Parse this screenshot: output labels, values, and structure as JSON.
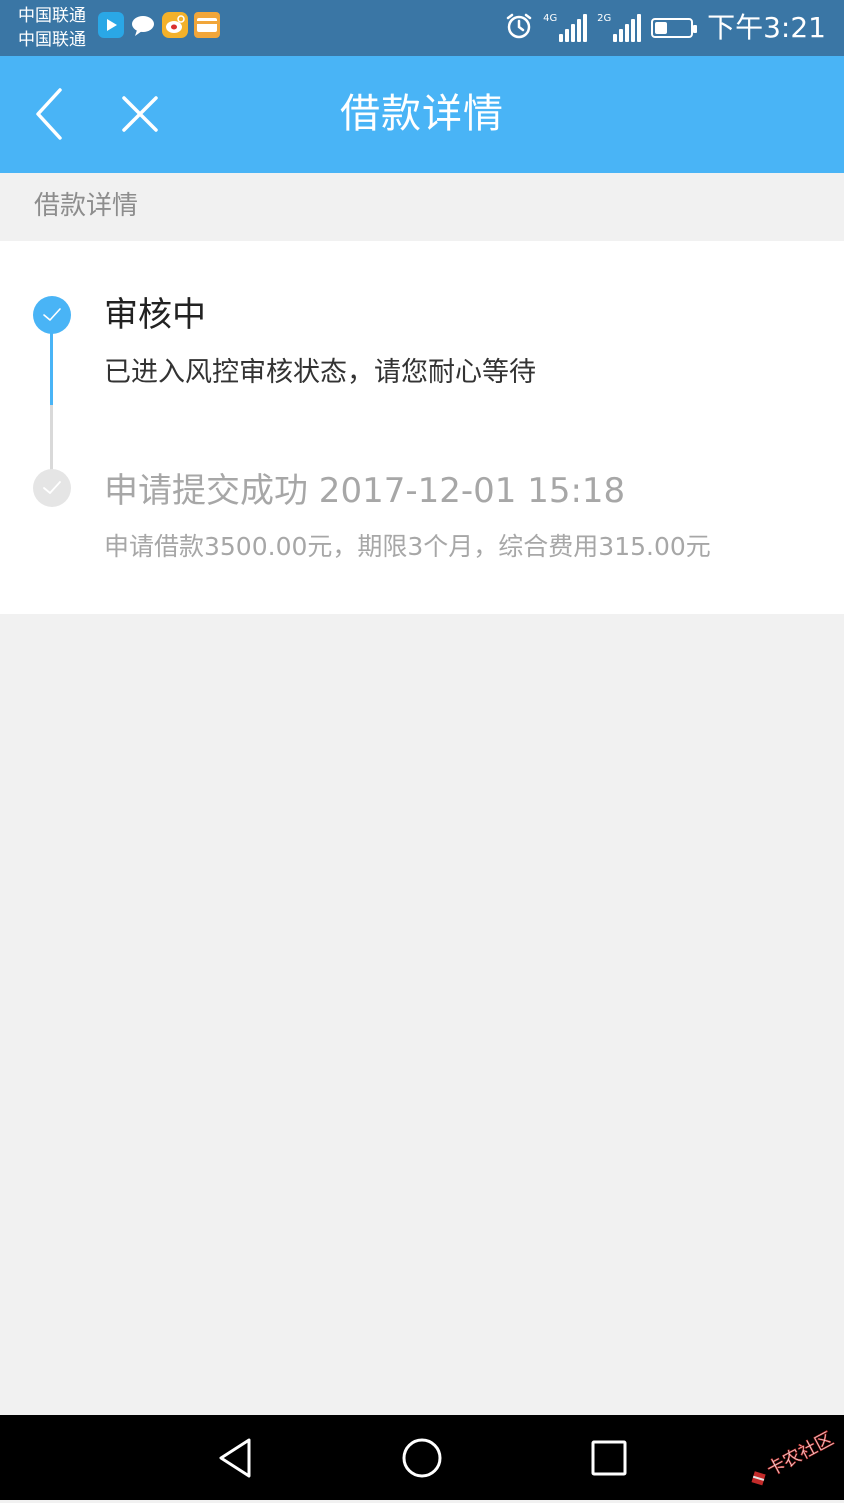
{
  "status_bar": {
    "carrier_1": "中国联通",
    "carrier_2": "中国联通",
    "time": "下午3:21",
    "network_1": "4G",
    "network_2": "2G",
    "battery_level": 0.35,
    "icons": [
      "video-app-icon",
      "chat-app-icon",
      "weibo-app-icon",
      "wallet-app-icon",
      "alarm-icon",
      "signal-icon",
      "battery-icon"
    ]
  },
  "header": {
    "title": "借款详情",
    "back_icon": "chevron-left-icon",
    "close_icon": "close-icon",
    "background": "#49b4f6"
  },
  "section": {
    "label": "借款详情"
  },
  "timeline": {
    "steps": [
      {
        "status": "current",
        "title": "审核中",
        "description": "已进入风控审核状态，请您耐心等待",
        "icon": "check-icon",
        "color": "#49b4f6"
      },
      {
        "status": "done",
        "title": "申请提交成功 2017-12-01 15:18",
        "description": "申请借款3500.00元，期限3个月，综合费用315.00元",
        "icon": "check-icon",
        "color": "#e5e5e5"
      }
    ]
  },
  "nav_bar": {
    "back_icon": "triangle-back-icon",
    "home_icon": "circle-home-icon",
    "recent_icon": "square-recent-icon"
  },
  "colors": {
    "accent": "#49b4f6",
    "status_bar": "#3a76a5",
    "page_bg": "#f1f1f1",
    "muted_text": "#a7a7a7"
  }
}
